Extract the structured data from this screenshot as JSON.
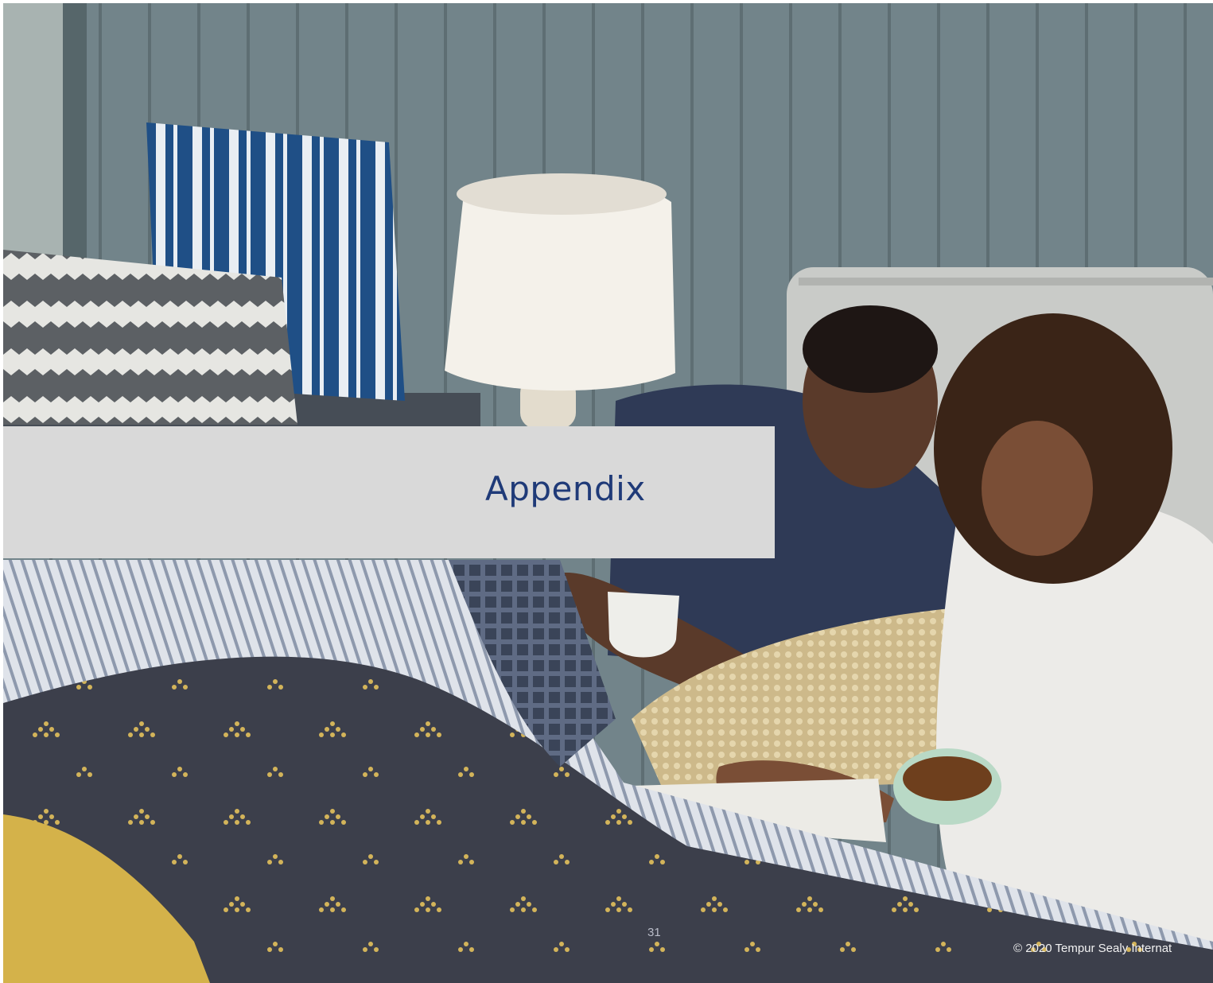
{
  "slide": {
    "title": "Appendix",
    "page_number": "31",
    "copyright": "© 2020 Tempur Sealy Internat",
    "colors": {
      "title": "#1f3a78",
      "band": "#d9d9d9"
    }
  },
  "background_image": {
    "subject": "couple-in-bed-photo",
    "icon": "photo-icon"
  }
}
